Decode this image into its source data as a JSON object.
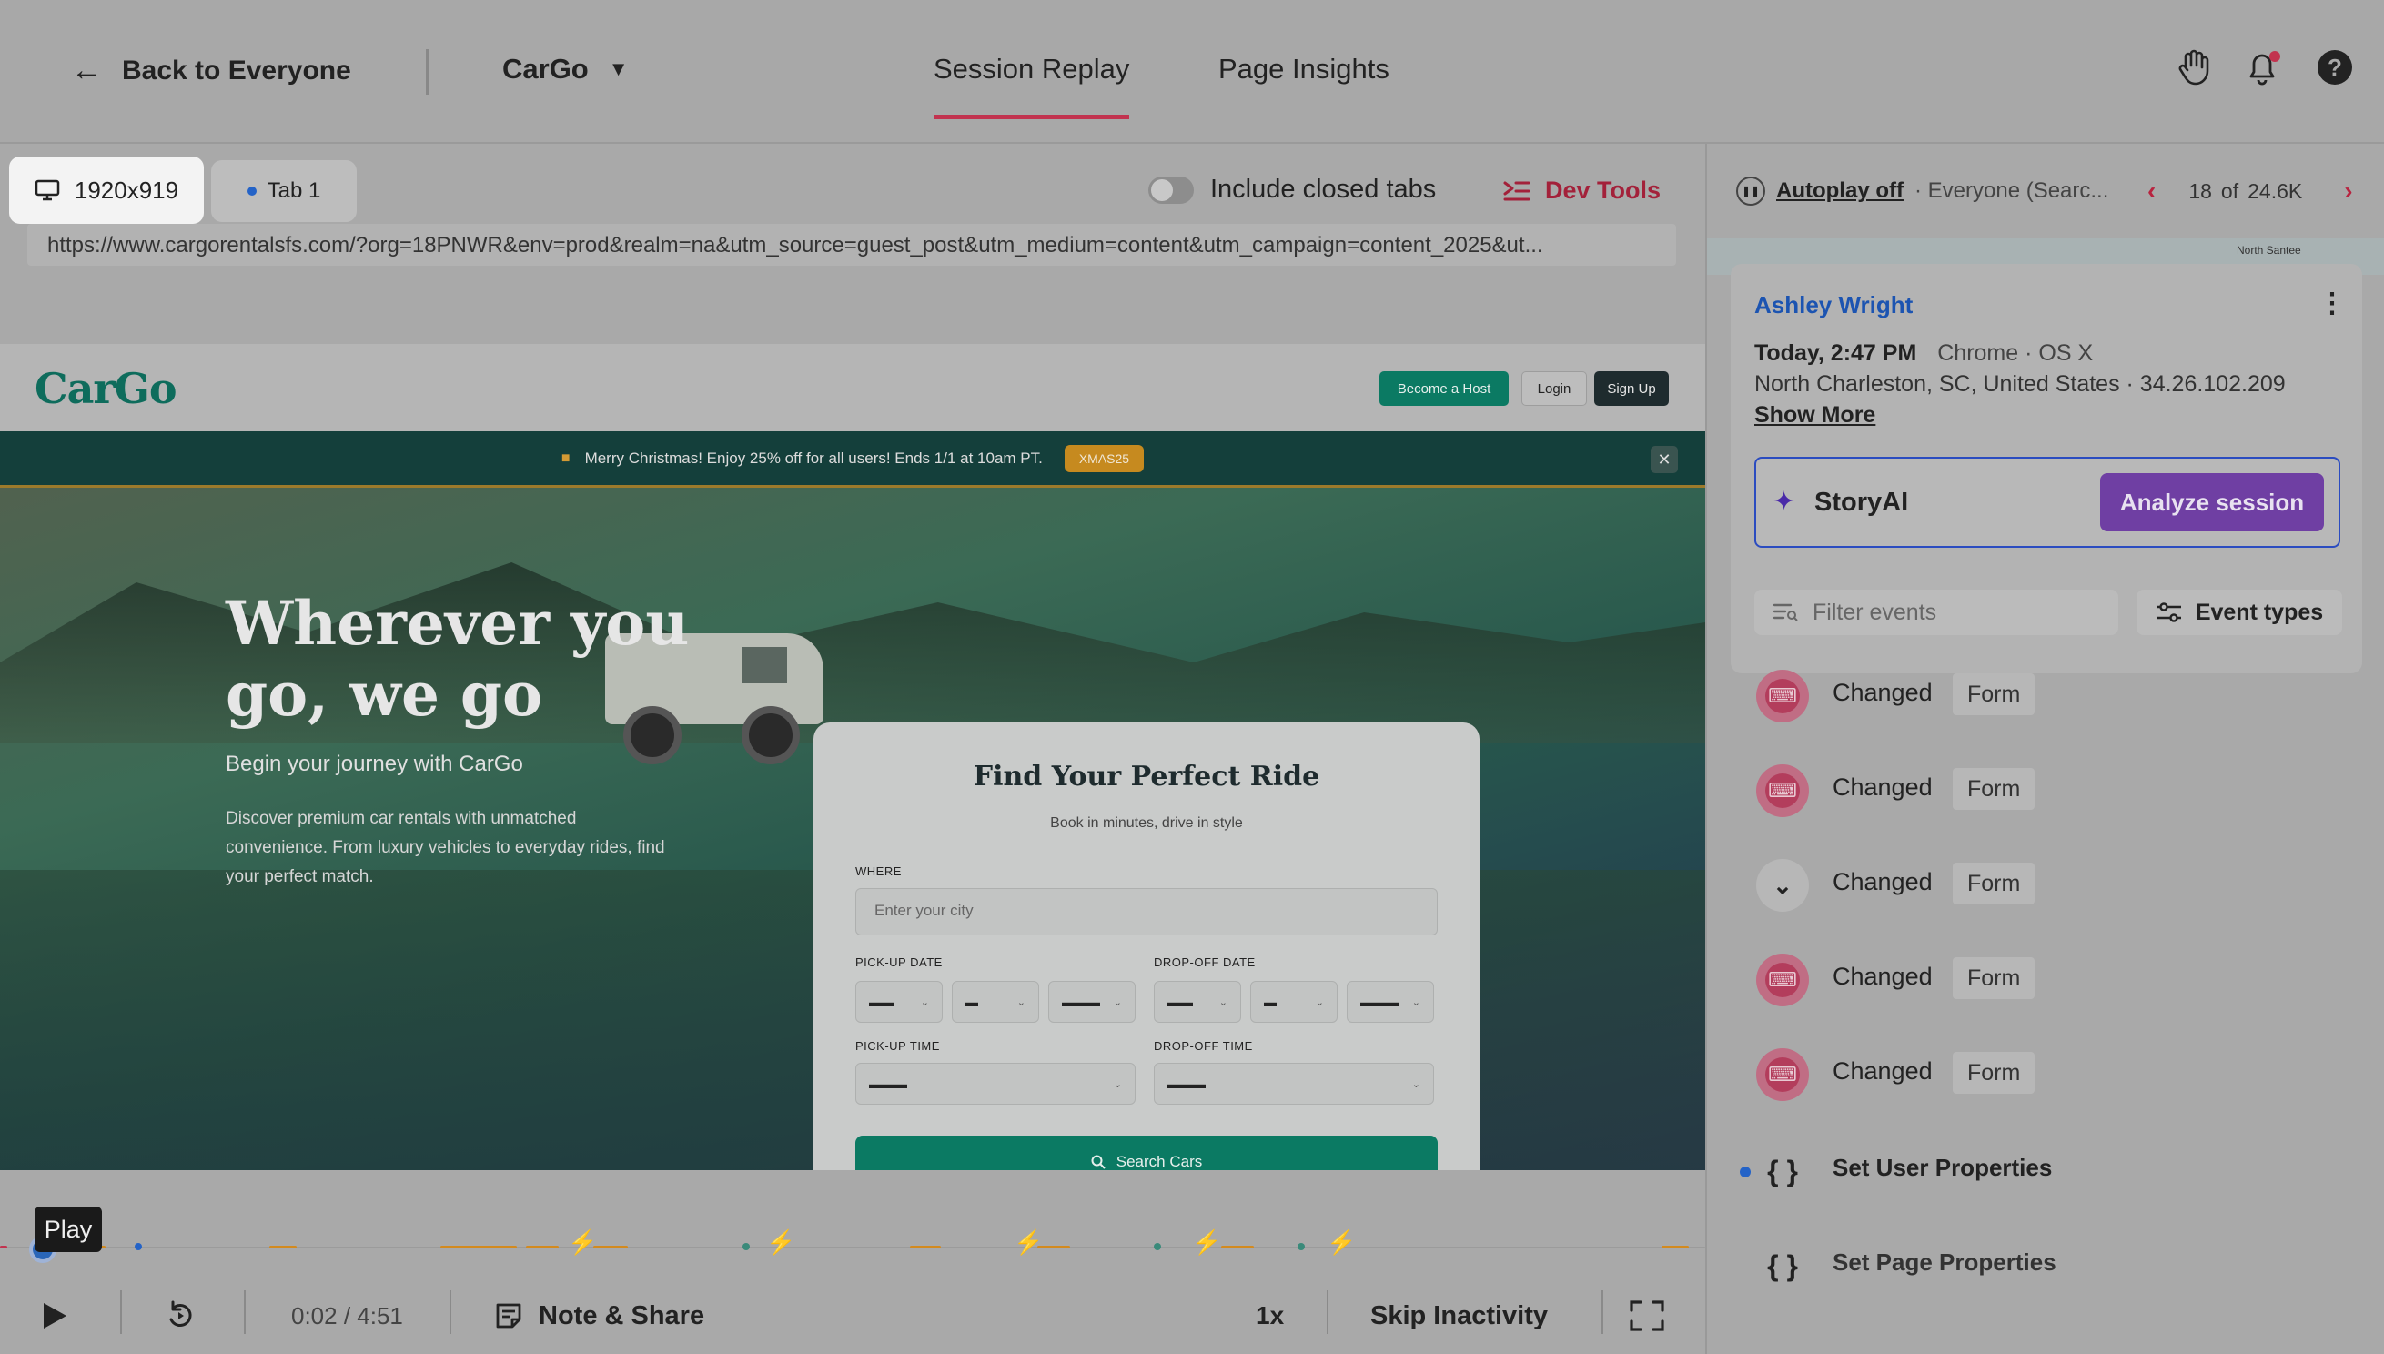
{
  "topbar": {
    "back_label": "Back to Everyone",
    "app_name": "CarGo",
    "tabs": [
      {
        "label": "Session Replay",
        "active": true
      },
      {
        "label": "Page Insights",
        "active": false
      }
    ],
    "icons": [
      "hand-icon",
      "bell-icon",
      "help-icon"
    ],
    "help_glyph": "?"
  },
  "player": {
    "resolution": "1920x919",
    "tab_label": "Tab 1",
    "include_closed_tabs_label": "Include closed tabs",
    "include_closed_tabs": false,
    "dev_tools_label": "Dev Tools",
    "url": "https://www.cargorentalsfs.com/?org=18PNWR&env=prod&realm=na&utm_source=guest_post&utm_medium=content&utm_campaign=content_2025&ut..."
  },
  "site": {
    "logo": "CarGo",
    "header_buttons": {
      "host": "Become a Host",
      "login": "Login",
      "signup": "Sign Up"
    },
    "promo_text": "Merry Christmas! Enjoy 25% off for all users! Ends 1/1 at 10am PT.",
    "promo_code": "XMAS25",
    "promo_close": "✕",
    "hero_title": "Wherever you go, we go",
    "hero_subtitle": "Begin your journey with CarGo",
    "hero_description": "Discover premium car rentals with unmatched convenience. From luxury vehicles to everyday rides, find your perfect match.",
    "card": {
      "title": "Find Your Perfect Ride",
      "subtitle": "Book in minutes, drive in style",
      "where_label": "WHERE",
      "where_placeholder": "Enter your city",
      "pickup_date_label": "PICK-UP DATE",
      "dropoff_date_label": "DROP-OFF DATE",
      "pickup_time_label": "PICK-UP TIME",
      "dropoff_time_label": "DROP-OFF TIME",
      "date_selects": [
        "▬▬",
        "▬",
        "▬▬▬"
      ],
      "time_select": "▬▬▬",
      "search_label": "Search Cars"
    }
  },
  "timeline": {
    "tooltip": "Play",
    "progress": 0.007
  },
  "controls": {
    "time": "0:02 / 4:51",
    "note_share": "Note & Share",
    "speed": "1x",
    "skip_inactivity": "Skip Inactivity"
  },
  "right_panel": {
    "autoplay_label": "Autoplay off",
    "segment": "· Everyone (Searc...",
    "page_current": "18",
    "page_of": "of",
    "page_total": "24.6K",
    "map_labels": [
      "North Santee"
    ],
    "user": {
      "name": "Ashley Wright",
      "time": "Today, 2:47 PM",
      "browser_os": "Chrome · OS X",
      "location": "North Charleston, SC, United States · 34.26.102.209",
      "show_more": "Show More"
    },
    "storyai_label": "StoryAI",
    "analyze_label": "Analyze session",
    "filter_placeholder": "Filter events",
    "event_types_label": "Event types",
    "events": [
      {
        "icon": "keyboard-icon",
        "name": "Changed",
        "tag": "Form"
      },
      {
        "icon": "keyboard-icon",
        "name": "Changed",
        "tag": "Form"
      },
      {
        "icon": "chevron-down-icon",
        "name": "Changed",
        "tag": "Form"
      },
      {
        "icon": "keyboard-icon",
        "name": "Changed",
        "tag": "Form"
      },
      {
        "icon": "keyboard-icon",
        "name": "Changed",
        "tag": "Form"
      },
      {
        "icon": "braces-icon",
        "name": "Set User Properties",
        "tag": ""
      },
      {
        "icon": "braces-icon",
        "name": "Set Page Properties",
        "tag": ""
      }
    ]
  },
  "colors": {
    "accent_red": "#c2334f",
    "brand_green": "#0b7a63",
    "link_blue": "#1c54b1",
    "purple": "#6f3fa3"
  }
}
